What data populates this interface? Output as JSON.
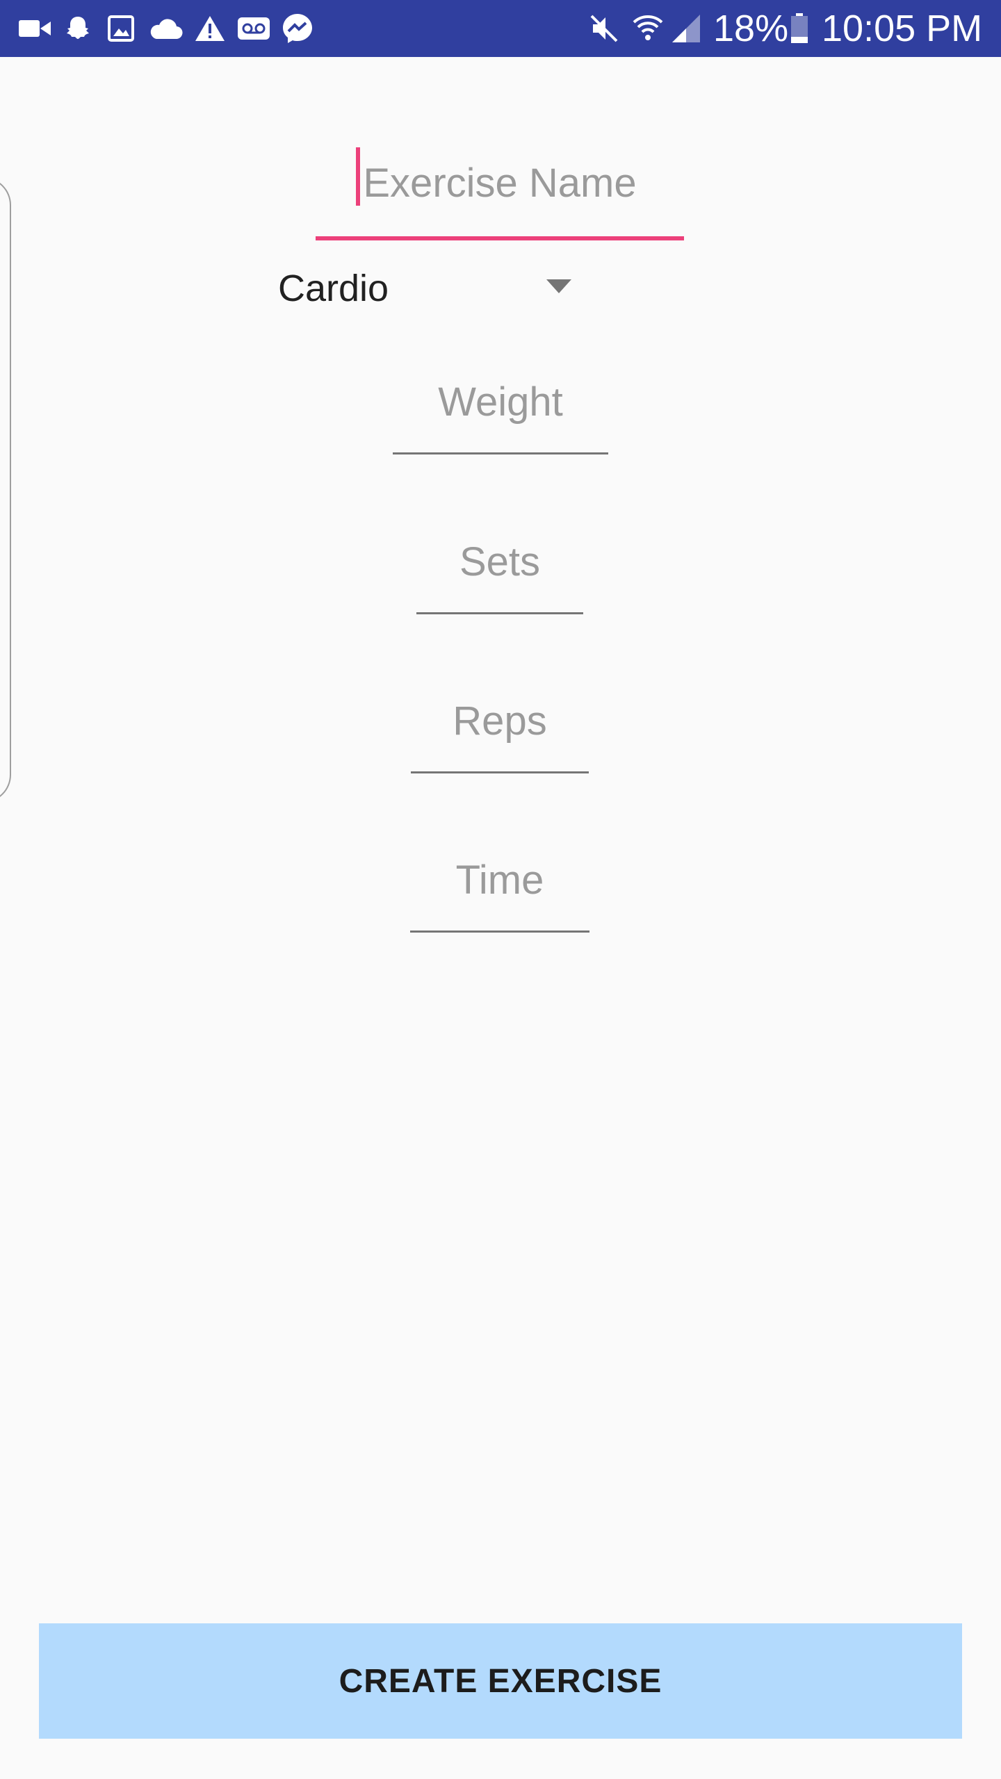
{
  "status_bar": {
    "notification_icons": [
      "video-icon",
      "snapchat-icon",
      "image-icon",
      "cloud-icon",
      "warning-icon",
      "voicemail-icon",
      "messenger-icon"
    ],
    "system_icons": [
      "mute-icon",
      "wifi-icon",
      "signal-icon",
      "battery-icon"
    ],
    "battery_percent": "18%",
    "time": "10:05 PM",
    "background_color": "#303f9f"
  },
  "form": {
    "exercise_name": {
      "placeholder": "Exercise Name",
      "value": ""
    },
    "category": {
      "selected": "Cardio"
    },
    "weight": {
      "placeholder": "Weight"
    },
    "sets": {
      "placeholder": "Sets"
    },
    "reps": {
      "placeholder": "Reps"
    },
    "time": {
      "placeholder": "Time"
    }
  },
  "actions": {
    "create_label": "CREATE EXERCISE"
  },
  "colors": {
    "accent": "#ec407a",
    "button_background": "#b3dafd",
    "page_background": "#fafafa"
  }
}
